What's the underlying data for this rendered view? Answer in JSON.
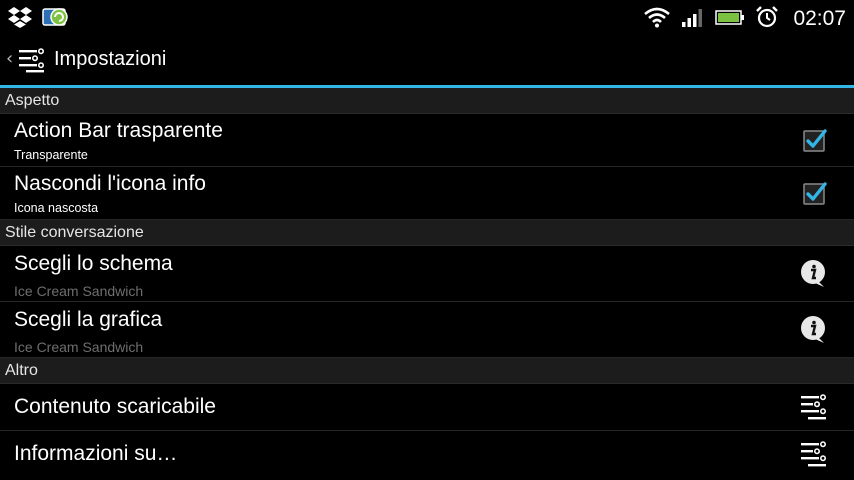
{
  "status_bar": {
    "time": "02:07",
    "icons": [
      "dropbox-icon",
      "app-sync-icon",
      "wifi-icon",
      "signal-icon",
      "battery-icon",
      "alarm-icon"
    ]
  },
  "action_bar": {
    "title": "Impostazioni",
    "accent": "#33b5e5"
  },
  "sections": {
    "aspetto": {
      "label": "Aspetto",
      "items": [
        {
          "title": "Action Bar trasparente",
          "subtitle": "Transparente",
          "checked": true
        },
        {
          "title": "Nascondi l'icona info",
          "subtitle": "Icona nascosta",
          "checked": true
        }
      ]
    },
    "stile": {
      "label": "Stile conversazione",
      "items": [
        {
          "title": "Scegli lo schema",
          "subtitle": "Ice Cream Sandwich",
          "icon": "info-icon"
        },
        {
          "title": "Scegli la grafica",
          "subtitle": "Ice Cream Sandwich",
          "icon": "info-icon"
        }
      ]
    },
    "altro": {
      "label": "Altro",
      "items": [
        {
          "title": "Contenuto scaricabile",
          "icon": "settings-list-icon"
        },
        {
          "title": "Informazioni su…",
          "icon": "settings-list-icon"
        }
      ]
    }
  }
}
